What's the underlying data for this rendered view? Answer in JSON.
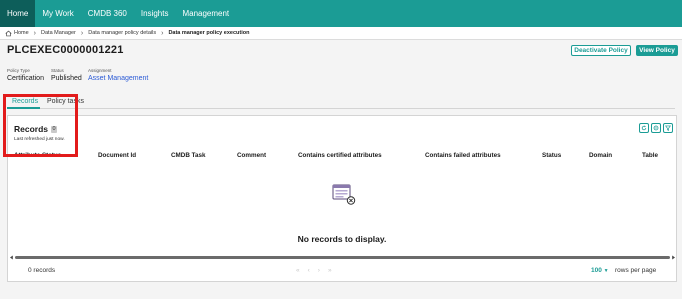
{
  "nav": {
    "items": [
      {
        "label": "Home",
        "active": true
      },
      {
        "label": "My Work",
        "active": false
      },
      {
        "label": "CMDB 360",
        "active": false
      },
      {
        "label": "Insights",
        "active": false
      },
      {
        "label": "Management",
        "active": false
      }
    ]
  },
  "breadcrumb": {
    "items": [
      "Home",
      "Data Manager",
      "Data manager policy details",
      "Data manager policy execution"
    ]
  },
  "header": {
    "title": "PLCEXEC0000001221",
    "deactivate_label": "Deactivate Policy",
    "view_label": "View Policy"
  },
  "meta": {
    "policy_type": {
      "label": "Policy Type",
      "value": "Certification"
    },
    "status": {
      "label": "Status",
      "value": "Published"
    },
    "assignment": {
      "label": "Assignment",
      "value": "Asset Management"
    }
  },
  "tabs": [
    {
      "label": "Records",
      "active": true
    },
    {
      "label": "Policy tasks",
      "active": false
    }
  ],
  "records": {
    "title": "Records",
    "count": "0",
    "refresh_text": "Last refreshed just now.",
    "columns": [
      "Attribute Status",
      "Document Id",
      "CMDB Task",
      "Comment",
      "Contains certified attributes",
      "Contains failed attributes",
      "Status",
      "Domain",
      "Table"
    ],
    "empty_message": "No records to display.",
    "records_count": "0 records",
    "per_page_value": "100",
    "per_page_label": "rows per page"
  },
  "colors": {
    "nav": "#1b9c95",
    "nav_active": "#0d5e5a",
    "accent": "#1b9c95",
    "link": "#2c5bd6",
    "highlight": "#e21b1b"
  },
  "icons": [
    "home-icon",
    "refresh-icon",
    "settings-icon",
    "filter-icon",
    "empty-records-icon",
    "chevron-down-icon"
  ]
}
